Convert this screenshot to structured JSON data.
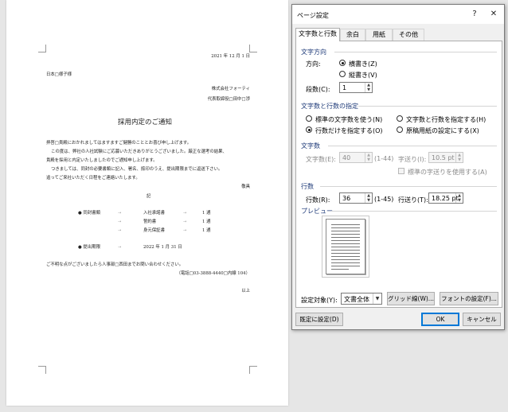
{
  "document": {
    "date": "2021 年 12 月 1 日",
    "recipient": "日本□様子様",
    "company": "株式会社フォーティ",
    "representative": "代表取締役□田中□渉",
    "title": "採用内定のご通知",
    "body": [
      "拝啓□貴殿におかれましてはますますご健勝のこととお喜び申し上げます。",
      "この度は、弊社の人社試験にご応募いただきありがとうございました。厳正な選考の結果、",
      "貴殿を採用と内定いたしましたのでご通知申し上げます。",
      "つきましては、同封の必要書類に記入、署名、捺印のうえ、提出期限までに返送下さい。",
      "追ってご来社いただく日程をご連絡いたします。"
    ],
    "closing_word": "敬具",
    "note_heading": "記",
    "enclosure_label": "同封書類",
    "enclosures": [
      {
        "name": "入社承諾書",
        "qty": "1 通"
      },
      {
        "name": "誓約書",
        "qty": "1 通"
      },
      {
        "name": "身元保証書",
        "qty": "1 通"
      }
    ],
    "deadline_label": "提出期限",
    "deadline": "2022 年 1 月 31 日",
    "inquiry": "ご不明な点がございましたら人事部□西田までお問い合わせください。",
    "phone": "（電話□03-3888-4440□内線 104）",
    "end": "以上"
  },
  "dialog": {
    "title": "ページ設定",
    "help": "?",
    "close": "✕",
    "tabs": [
      "文字数と行数",
      "余白",
      "用紙",
      "その他"
    ],
    "direction": {
      "heading": "文字方向",
      "label": "方向:",
      "horizontal": "横書き(Z)",
      "vertical": "縦書き(V)",
      "columns_label": "段数(C):",
      "columns_value": "1"
    },
    "grid": {
      "heading": "文字数と行数の指定",
      "opt1": "標準の文字数を使う(N)",
      "opt2": "文字数と行数を指定する(H)",
      "opt3": "行数だけを指定する(O)",
      "opt4": "原稿用紙の設定にする(X)"
    },
    "chars": {
      "heading": "文字数",
      "count_label": "文字数(E):",
      "count_value": "40",
      "count_range": "(1-44)",
      "pitch_label": "字送り(I):",
      "pitch_value": "10.5 pt",
      "default_pitch": "標準の字送りを使用する(A)"
    },
    "lines": {
      "heading": "行数",
      "count_label": "行数(R):",
      "count_value": "36",
      "count_range": "(1-45)",
      "pitch_label": "行送り(T):",
      "pitch_value": "18.25 pt"
    },
    "preview_label": "プレビュー",
    "apply_label": "設定対象(Y):",
    "apply_value": "文書全体",
    "grid_button": "グリッド線(W)...",
    "font_button": "フォントの設定(F)...",
    "default_button": "既定に設定(D)",
    "ok": "OK",
    "cancel": "キャンセル"
  }
}
